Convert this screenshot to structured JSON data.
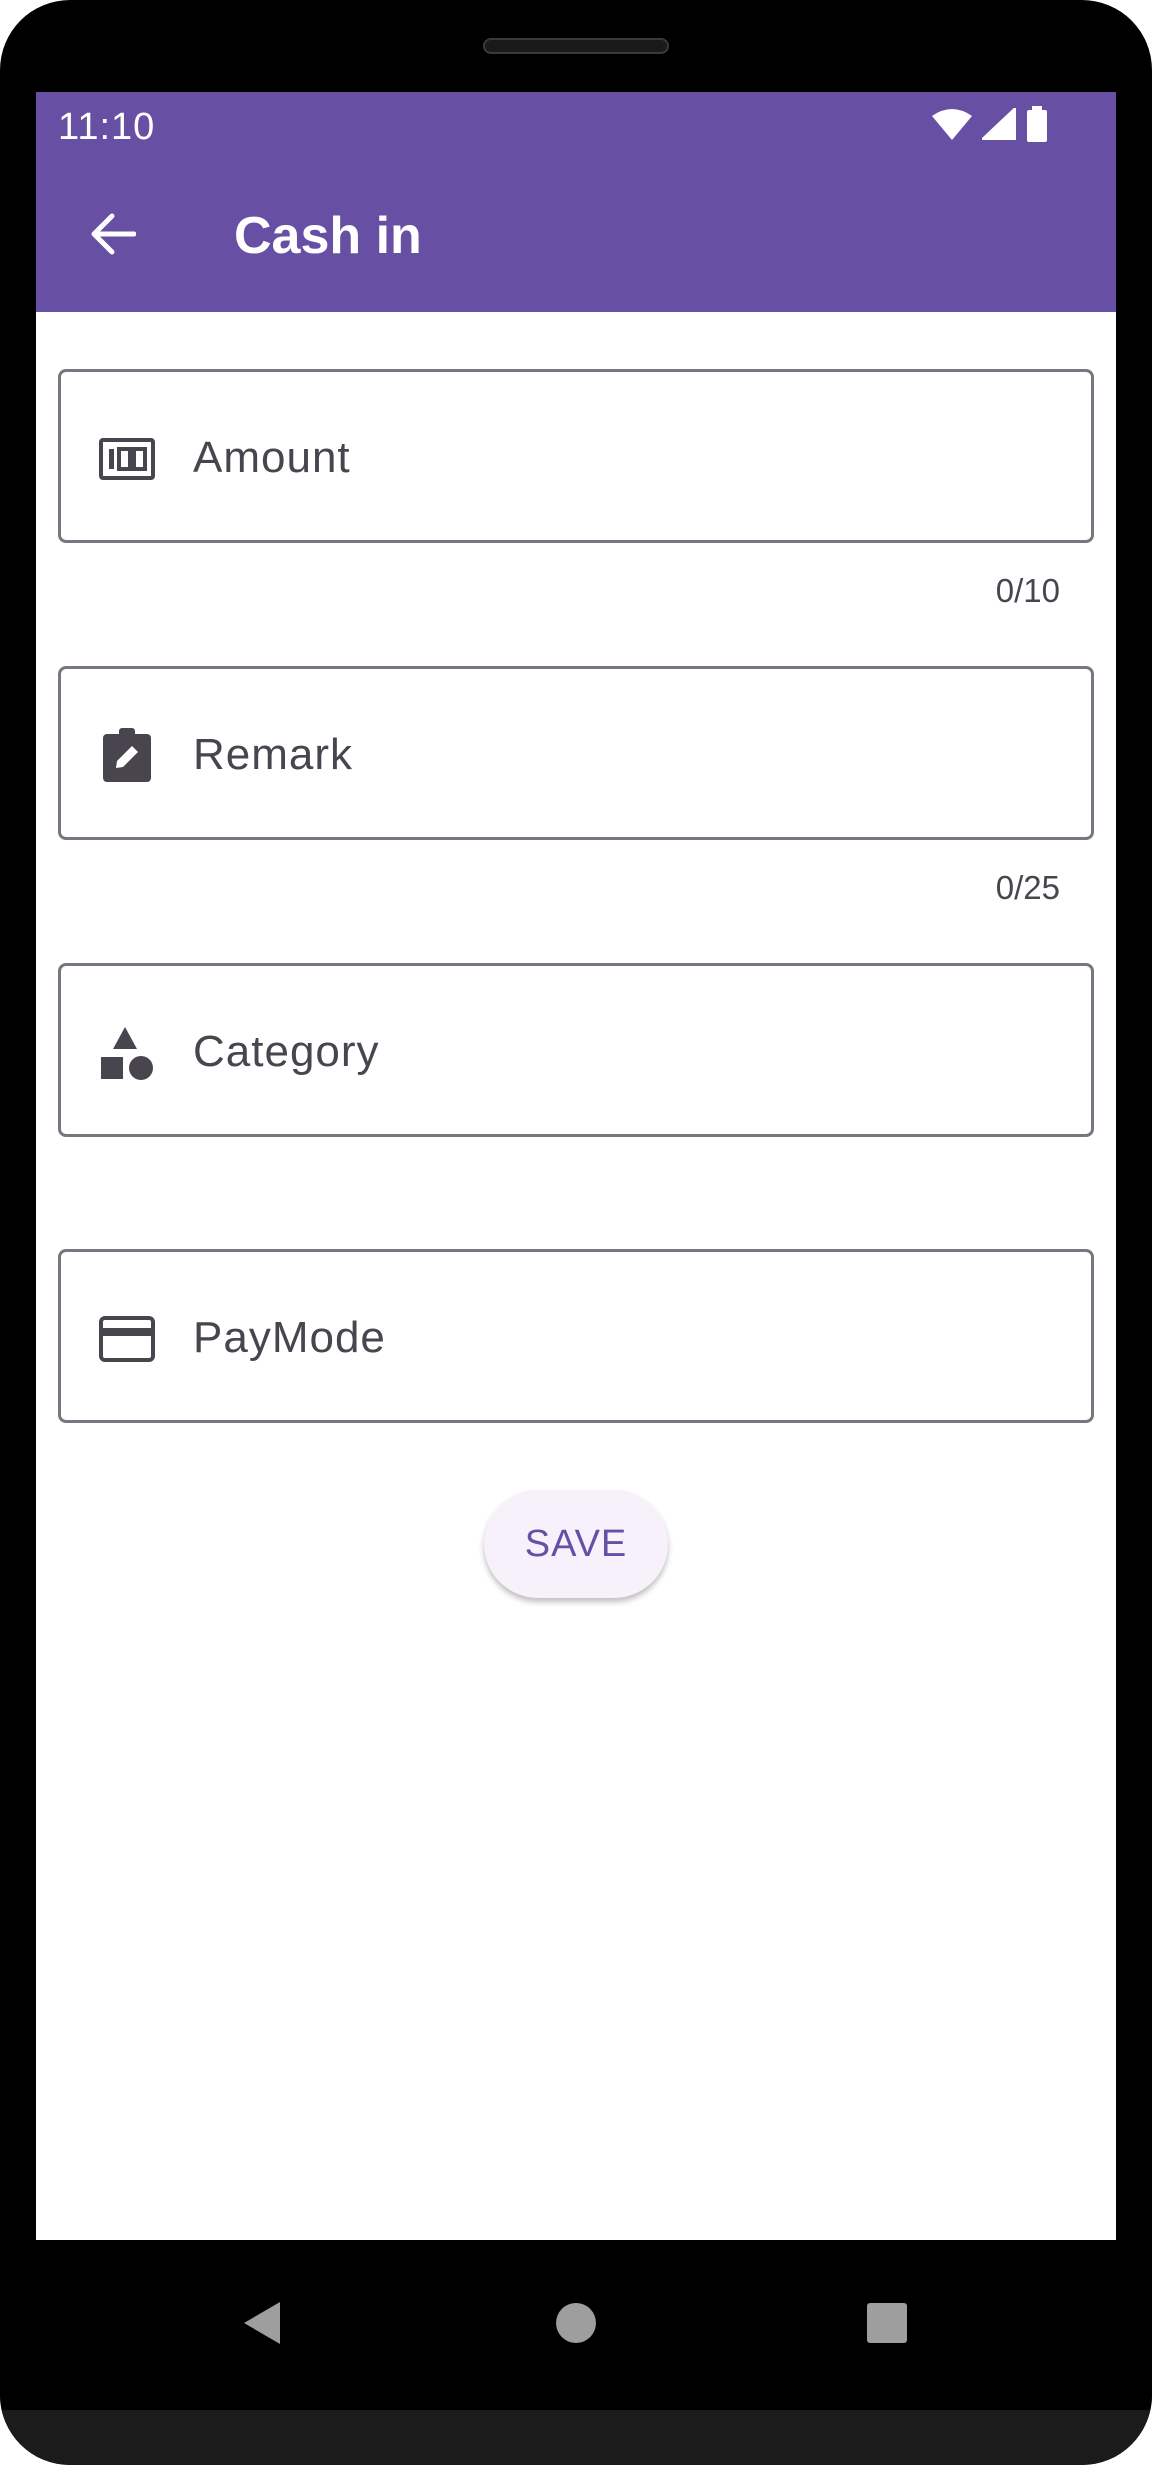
{
  "colors": {
    "primary": "#6750a4",
    "on_primary": "#ffffff",
    "outline": "#7a757f",
    "icon": "#49454f",
    "button_bg": "#f6f1fa"
  },
  "status_bar": {
    "time": "11:10",
    "icons": [
      "wifi-icon",
      "cell-signal-icon",
      "battery-icon"
    ]
  },
  "app_bar": {
    "back_icon": "arrow-back-icon",
    "title": "Cash in"
  },
  "form": {
    "amount": {
      "label": "Amount",
      "icon": "money-icon",
      "counter": "0/10"
    },
    "remark": {
      "label": "Remark",
      "icon": "edit-note-icon",
      "counter": "0/25"
    },
    "category": {
      "label": "Category",
      "icon": "category-shapes-icon"
    },
    "paymode": {
      "label": "PayMode",
      "icon": "credit-card-icon"
    },
    "save_label": "SAVE"
  },
  "nav_bar": {
    "icons": [
      "back-triangle-icon",
      "home-circle-icon",
      "recents-square-icon"
    ]
  }
}
